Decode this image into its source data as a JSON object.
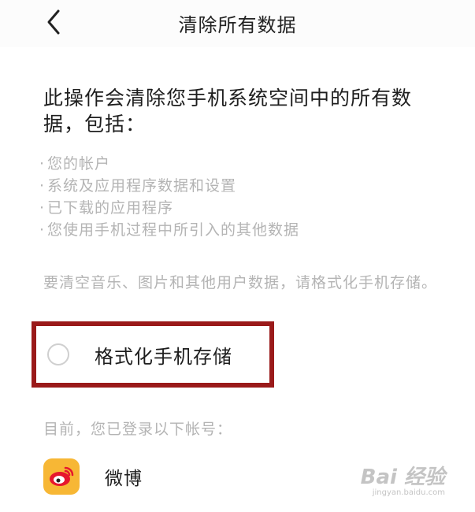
{
  "header": {
    "title": "清除所有数据",
    "back_icon": "chevron-left-icon"
  },
  "main": {
    "description": "此操作会清除您手机系统空间中的所有数据，包括：",
    "items": [
      "您的帐户",
      "系统及应用程序数据和设置",
      "已下载的应用程序",
      "您使用手机过程中所引入的其他数据"
    ],
    "note": "要清空音乐、图片和其他用户数据，请格式化手机存储。"
  },
  "format_option": {
    "label": "格式化手机存储",
    "checked": false,
    "highlight_color": "#9a1a1a"
  },
  "accounts": {
    "label": "目前，您已登录以下帐号：",
    "items": [
      {
        "name": "微博",
        "icon": "weibo-icon",
        "icon_color": "#f7b735"
      }
    ]
  },
  "watermark": {
    "main": "Bai 经验",
    "sub": "jingyan.baidu.com"
  }
}
